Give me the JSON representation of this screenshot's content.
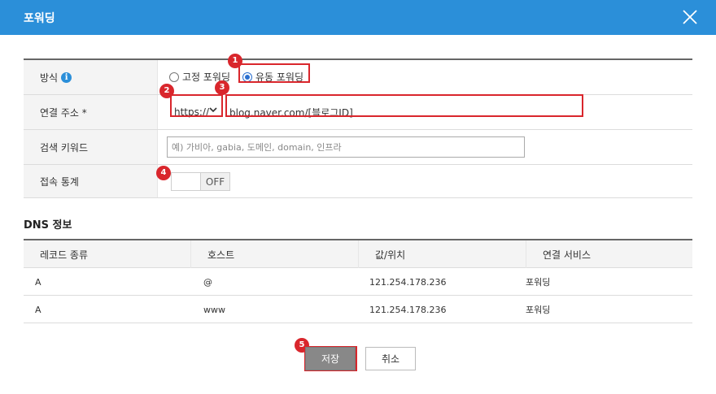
{
  "dialog": {
    "title": "포워딩"
  },
  "form": {
    "method_label": "방식",
    "method_options": [
      "고정 포워딩",
      "유동 포워딩"
    ],
    "method_selected": "유동 포워딩",
    "address_label": "연결 주소 *",
    "protocol_value": "https://",
    "address_value": "blog.naver.com/[블로그ID]",
    "keyword_label": "검색 키워드",
    "keyword_placeholder": "예) 가비아, gabia, 도메인, domain, 인프라",
    "stats_label": "접속 통계",
    "stats_toggle": "OFF"
  },
  "dns": {
    "title": "DNS 정보",
    "columns": [
      "레코드 종류",
      "호스트",
      "값/위치",
      "연결 서비스"
    ],
    "rows": [
      [
        "A",
        "@",
        "121.254.178.236",
        "포워딩"
      ],
      [
        "A",
        "www",
        "121.254.178.236",
        "포워딩"
      ]
    ]
  },
  "buttons": {
    "save": "저장",
    "cancel": "취소"
  },
  "annotations": [
    "1",
    "2",
    "3",
    "4",
    "5"
  ],
  "colors": {
    "header": "#2b8fd9",
    "annotation": "#d9262c",
    "radio_selected": "#2b6fcf"
  }
}
